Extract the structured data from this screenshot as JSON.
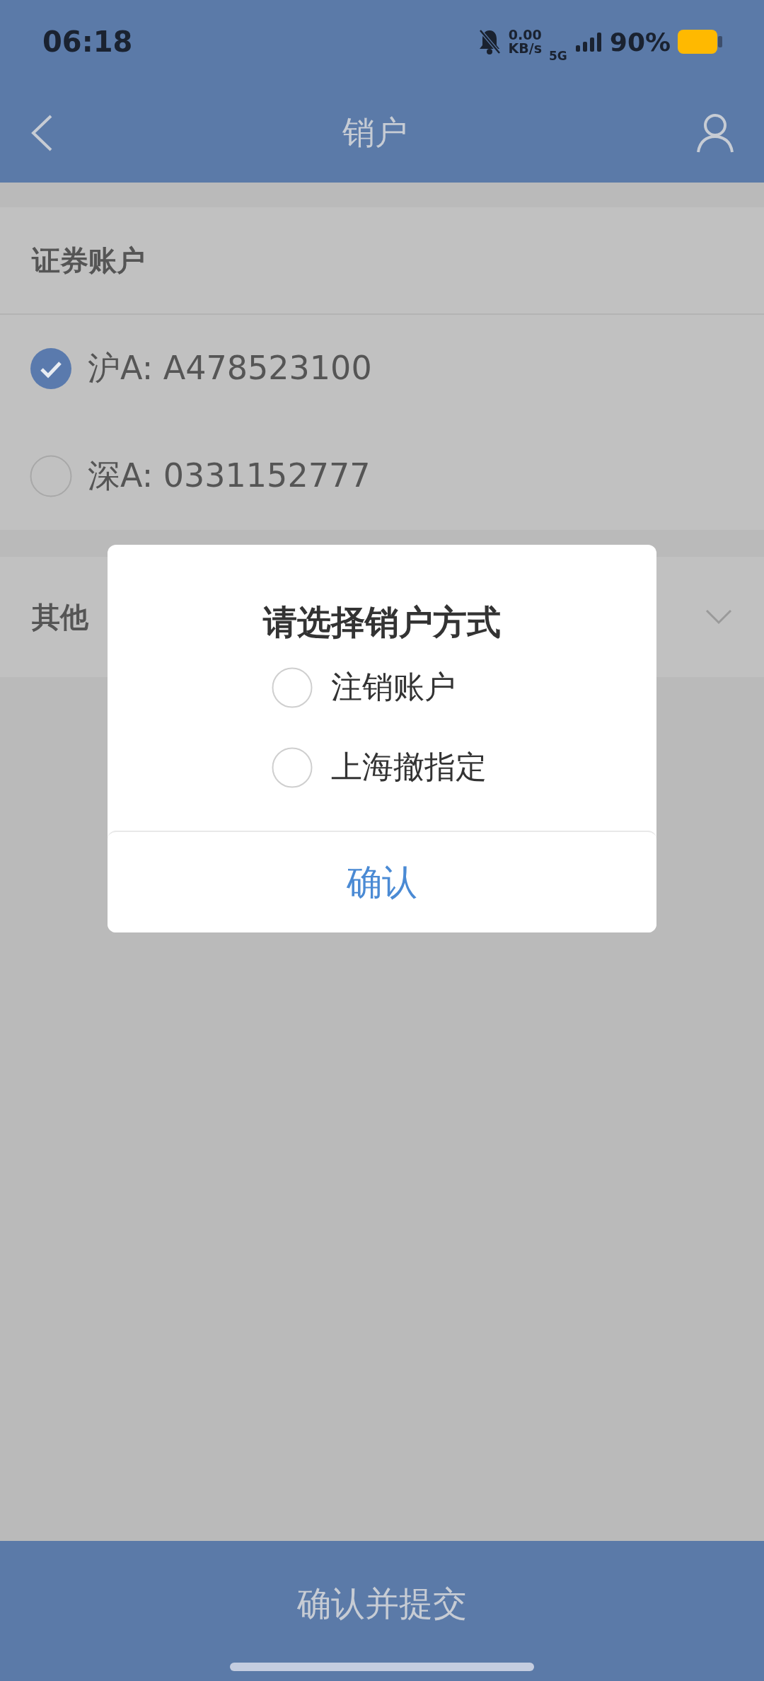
{
  "status_bar": {
    "time": "06:18",
    "net_speed": "0.00",
    "net_unit": "KB/s",
    "network": "5G",
    "battery": "90%"
  },
  "header": {
    "title": "销户"
  },
  "accounts": {
    "title": "证券账户",
    "items": [
      {
        "label": "沪A: A478523100",
        "checked": true
      },
      {
        "label": "深A: 0331152777",
        "checked": false
      }
    ]
  },
  "other": {
    "title": "其他",
    "expanded": false
  },
  "dialog": {
    "title": "请选择销户方式",
    "options": [
      {
        "label": "注销账户",
        "selected": false
      },
      {
        "label": "上海撤指定",
        "selected": false
      }
    ],
    "confirm": "确认"
  },
  "submit": "确认并提交"
}
